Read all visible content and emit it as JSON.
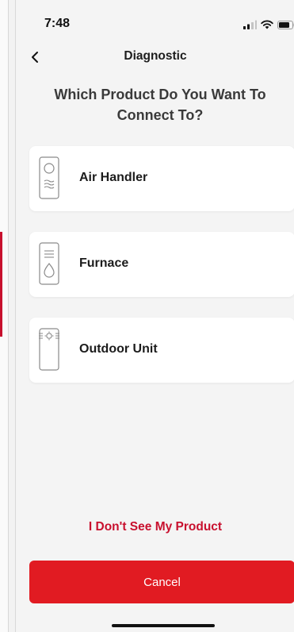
{
  "status_bar": {
    "time": "7:48",
    "icons": [
      "signal-icon",
      "wifi-icon",
      "battery-icon"
    ]
  },
  "nav": {
    "title": "Diagnostic",
    "back_icon": "chevron-left-icon"
  },
  "question": "Which Product Do You Want To Connect To?",
  "products": [
    {
      "label": "Air Handler",
      "icon": "air-handler-icon"
    },
    {
      "label": "Furnace",
      "icon": "furnace-icon"
    },
    {
      "label": "Outdoor Unit",
      "icon": "outdoor-unit-icon"
    }
  ],
  "no_product_link": "I Don't See My Product",
  "cancel_label": "Cancel",
  "colors": {
    "accent": "#e11b22",
    "link": "#c8102e",
    "background": "#f4f4f4",
    "card": "#ffffff"
  }
}
